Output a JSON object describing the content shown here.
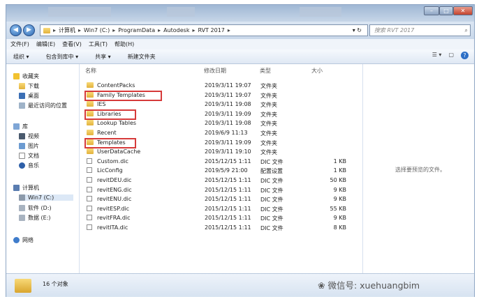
{
  "address": {
    "segments": [
      "计算机",
      "Win7 (C:)",
      "ProgramData",
      "Autodesk",
      "RVT 2017"
    ],
    "search_placeholder": "搜索 RVT 2017"
  },
  "menu": [
    "文件(F)",
    "编辑(E)",
    "查看(V)",
    "工具(T)",
    "帮助(H)"
  ],
  "toolbar": [
    "组织 ▾",
    "包含到库中 ▾",
    "共享 ▾",
    "新建文件夹"
  ],
  "nav": {
    "favorites": "收藏夹",
    "favorites_items": [
      "下载",
      "桌面",
      "最近访问的位置"
    ],
    "libraries": "库",
    "libraries_items": [
      "视频",
      "图片",
      "文档",
      "音乐"
    ],
    "computer": "计算机",
    "computer_items": [
      "Win7 (C:)",
      "软件 (D:)",
      "数据 (E:)"
    ],
    "network": "网络"
  },
  "columns": {
    "name": "名称",
    "date": "修改日期",
    "type": "类型",
    "size": "大小"
  },
  "files": [
    {
      "name": "ContentPacks",
      "date": "2019/3/11 19:07",
      "type": "文件夹",
      "size": "",
      "kind": "folder"
    },
    {
      "name": "Family Templates",
      "date": "2019/3/11 19:07",
      "type": "文件夹",
      "size": "",
      "kind": "folder"
    },
    {
      "name": "IES",
      "date": "2019/3/11 19:08",
      "type": "文件夹",
      "size": "",
      "kind": "folder"
    },
    {
      "name": "Libraries",
      "date": "2019/3/11 19:09",
      "type": "文件夹",
      "size": "",
      "kind": "folder"
    },
    {
      "name": "Lookup Tables",
      "date": "2019/3/11 19:08",
      "type": "文件夹",
      "size": "",
      "kind": "folder"
    },
    {
      "name": "Recent",
      "date": "2019/6/9 11:13",
      "type": "文件夹",
      "size": "",
      "kind": "folder"
    },
    {
      "name": "Templates",
      "date": "2019/3/11 19:09",
      "type": "文件夹",
      "size": "",
      "kind": "folder"
    },
    {
      "name": "UserDataCache",
      "date": "2019/3/11 19:10",
      "type": "文件夹",
      "size": "",
      "kind": "folder"
    },
    {
      "name": "Custom.dic",
      "date": "2015/12/15 1:11",
      "type": "DIC 文件",
      "size": "1 KB",
      "kind": "file"
    },
    {
      "name": "LicConfig",
      "date": "2019/5/9 21:00",
      "type": "配置设置",
      "size": "1 KB",
      "kind": "file"
    },
    {
      "name": "revitDEU.dic",
      "date": "2015/12/15 1:11",
      "type": "DIC 文件",
      "size": "50 KB",
      "kind": "file"
    },
    {
      "name": "revitENG.dic",
      "date": "2015/12/15 1:11",
      "type": "DIC 文件",
      "size": "9 KB",
      "kind": "file"
    },
    {
      "name": "revitENU.dic",
      "date": "2015/12/15 1:11",
      "type": "DIC 文件",
      "size": "9 KB",
      "kind": "file"
    },
    {
      "name": "revitESP.dic",
      "date": "2015/12/15 1:11",
      "type": "DIC 文件",
      "size": "55 KB",
      "kind": "file"
    },
    {
      "name": "revitFRA.dic",
      "date": "2015/12/15 1:11",
      "type": "DIC 文件",
      "size": "9 KB",
      "kind": "file"
    },
    {
      "name": "revitITA.dic",
      "date": "2015/12/15 1:11",
      "type": "DIC 文件",
      "size": "8 KB",
      "kind": "file"
    }
  ],
  "highlighted": [
    "Family Templates",
    "Libraries",
    "Templates"
  ],
  "preview_text": "选择要预览的文件。",
  "status": "16 个对象",
  "watermark": "微信号: xuehuangbim",
  "colors": {
    "highlight": "#d63a3a",
    "folder": "#e9c04e",
    "titlebar": "#b3c6de"
  }
}
